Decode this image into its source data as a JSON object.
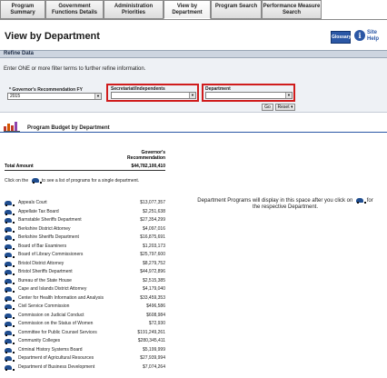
{
  "tabs": [
    {
      "label": "Program Summary",
      "active": false
    },
    {
      "label": "Government Functions Details",
      "active": false
    },
    {
      "label": "Administration Priorities",
      "active": false
    },
    {
      "label": "View by Department",
      "active": true
    },
    {
      "label": "Program Search",
      "active": false
    },
    {
      "label": "Performance Measure Search",
      "active": false
    }
  ],
  "header": {
    "title": "View by Department",
    "glossary_label": "Glossary",
    "site_help_icon": "i",
    "site_help_label": "Site Help"
  },
  "refine": {
    "bar_title": "Refine Data",
    "hint": "Enter ONE or more filter terms to further refine information.",
    "fy_label": "* Governor's Recommendation FY",
    "fy_value": "2015",
    "secretariat_label": "Secretariat/Independents",
    "secretariat_value": "",
    "department_label": "Department",
    "department_value": "",
    "go_label": "Go",
    "reset_label": "Reset"
  },
  "budget": {
    "title": "Program Budget by Department",
    "column_header": "Governor's Recommendation",
    "total_label": "Total Amount",
    "total_value": "$44,782,100,410",
    "click_hint_before": "Click on the",
    "click_hint_after": "to see a list of programs for a single department.",
    "right_message_before": "Department Programs will display in this space after you click on",
    "right_message_after": "for the respective Department.",
    "rows": [
      {
        "name": "Appeals Court",
        "amount": "$13,077,357"
      },
      {
        "name": "Appellate Tax Board",
        "amount": "$2,251,638"
      },
      {
        "name": "Barnstable Sheriffs Department",
        "amount": "$27,354,299"
      },
      {
        "name": "Berkshire District Attorney",
        "amount": "$4,097,016"
      },
      {
        "name": "Berkshire Sheriffs Department",
        "amount": "$16,875,691"
      },
      {
        "name": "Board of Bar Examiners",
        "amount": "$1,203,173"
      },
      {
        "name": "Board of Library Commissioners",
        "amount": "$25,797,600"
      },
      {
        "name": "Bristol District Attorney",
        "amount": "$8,279,752"
      },
      {
        "name": "Bristol Sheriffs Department",
        "amount": "$44,972,896"
      },
      {
        "name": "Bureau of the State House",
        "amount": "$2,515,385"
      },
      {
        "name": "Cape and Islands District Attorney",
        "amount": "$4,179,040"
      },
      {
        "name": "Center for Health Information and Analysis",
        "amount": "$33,459,353"
      },
      {
        "name": "Civil Service Commission",
        "amount": "$496,586"
      },
      {
        "name": "Commission on Judicial Conduct",
        "amount": "$608,984"
      },
      {
        "name": "Commission on the Status of Women",
        "amount": "$72,930"
      },
      {
        "name": "Committee for Public Counsel Services",
        "amount": "$191,249,261"
      },
      {
        "name": "Community Colleges",
        "amount": "$280,345,411"
      },
      {
        "name": "Criminal History Systems Board",
        "amount": "$5,199,999"
      },
      {
        "name": "Department of Agricultural Resources",
        "amount": "$27,939,994"
      },
      {
        "name": "Department of Business Development",
        "amount": "$7,074,264"
      }
    ]
  }
}
